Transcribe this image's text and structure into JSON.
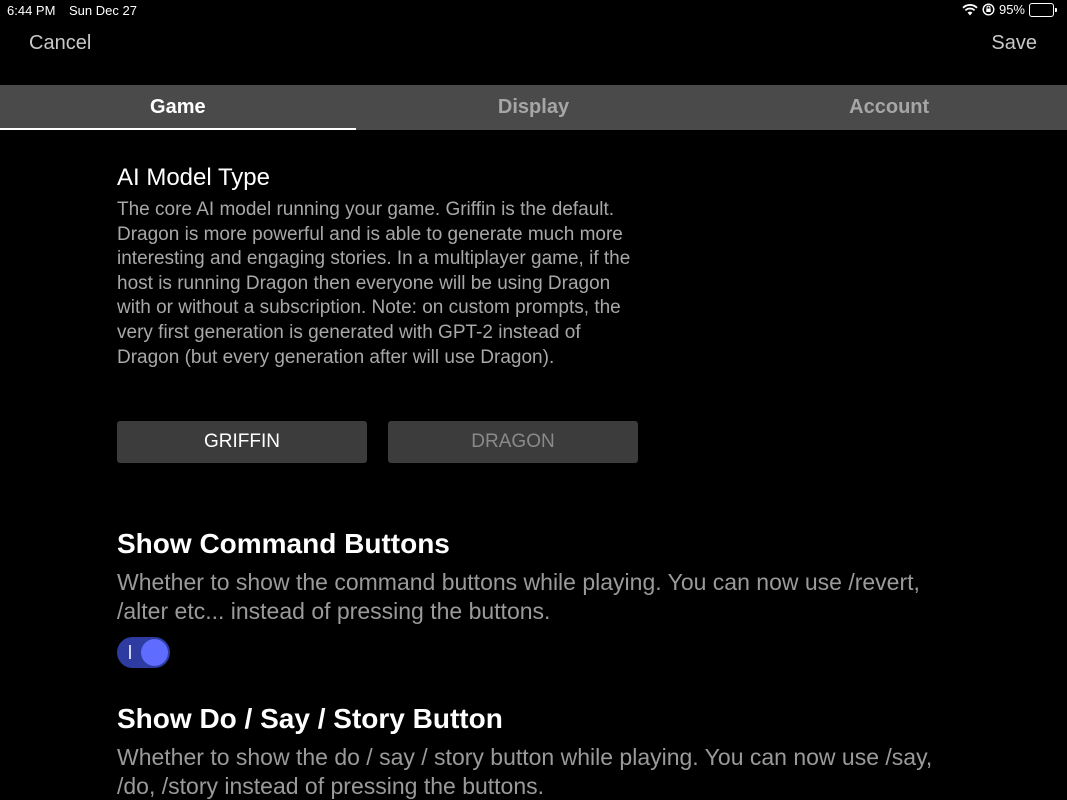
{
  "status_bar": {
    "time": "6:44 PM",
    "date": "Sun Dec 27",
    "battery_percent": "95%",
    "battery_level": 0.95,
    "icons": [
      "wifi-icon",
      "lock-rotation-icon",
      "battery-icon"
    ]
  },
  "nav": {
    "cancel_label": "Cancel",
    "save_label": "Save"
  },
  "tabs": [
    {
      "label": "Game",
      "active": true
    },
    {
      "label": "Display",
      "active": false
    },
    {
      "label": "Account",
      "active": false
    }
  ],
  "ai_model": {
    "title": "AI Model Type",
    "description": "The core AI model running your game. Griffin is the default. Dragon is more powerful and is able to generate much more interesting and engaging stories. In a multiplayer game, if the host is running Dragon then everyone will be using Dragon with or without a subscription. Note: on custom prompts, the very first generation is generated with GPT-2 instead of Dragon (but every generation after will use Dragon).",
    "options": [
      {
        "label": "GRIFFIN",
        "selected": true
      },
      {
        "label": "DRAGON",
        "selected": false
      }
    ]
  },
  "command_buttons": {
    "title": "Show Command Buttons",
    "description": "Whether to show the command buttons while playing. You can now use /revert, /alter etc... instead of pressing the buttons.",
    "toggle_on": true,
    "toggle_mark": "I"
  },
  "do_say_story": {
    "title": "Show Do / Say / Story Button",
    "description": "Whether to show the do / say / story button while playing. You can now use /say, /do, /story instead of pressing the buttons."
  },
  "colors": {
    "background": "#000000",
    "tab_bar": "#4a4a4a",
    "button": "#3c3c3c",
    "toggle_track": "#2e3ba0",
    "toggle_knob": "#5e6cff"
  }
}
